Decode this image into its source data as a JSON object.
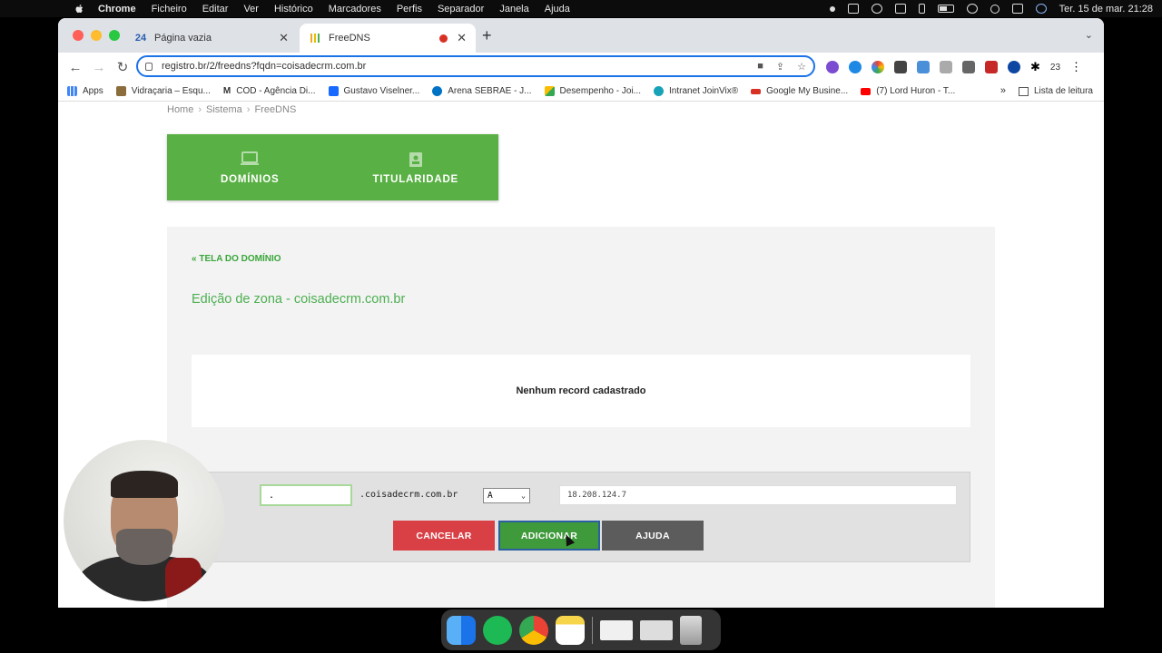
{
  "menubar": {
    "app": "Chrome",
    "items": [
      "Ficheiro",
      "Editar",
      "Ver",
      "Histórico",
      "Marcadores",
      "Perfis",
      "Separador",
      "Janela",
      "Ajuda"
    ],
    "datetime": "Ter. 15 de mar.  21:28"
  },
  "tabs": [
    {
      "label": "Página vazia",
      "favicon": "24"
    },
    {
      "label": "FreeDNS"
    }
  ],
  "address": {
    "url": "registro.br/2/freedns?fqdn=coisadecrm.com.br"
  },
  "extensions": {
    "count": "23"
  },
  "bookmarks": [
    {
      "label": "Apps",
      "color": "#4285f4"
    },
    {
      "label": "Vidraçaria – Esqu...",
      "color": "#8a6d3b"
    },
    {
      "label": "COD - Agência Di...",
      "color": "#111111",
      "glyph": "M"
    },
    {
      "label": "Gustavo Viselner...",
      "color": "#1769ff"
    },
    {
      "label": "Arena SEBRAE - J...",
      "color": "#0073c6"
    },
    {
      "label": "Desempenho - Joi...",
      "color": "#fbbc04"
    },
    {
      "label": "Intranet JoinVix®",
      "color": "#17a2b8"
    },
    {
      "label": "Google My Busine...",
      "color": "#d93025"
    },
    {
      "label": "(7) Lord Huron - T...",
      "color": "#ff0000"
    }
  ],
  "bookmarks_more": "»",
  "reading_list": "Lista de leitura",
  "breadcrumb": [
    "Home",
    "Sistema",
    "FreeDNS"
  ],
  "green_nav": [
    {
      "label": "DOMÍNIOS"
    },
    {
      "label": "TITULARIDADE"
    }
  ],
  "back_link": "« TELA DO DOMÍNIO",
  "zone_title": "Edição de zona - coisadecrm.com.br",
  "records_empty": "Nenhum record cadastrado",
  "form": {
    "host_value": ".",
    "domain_suffix": ".coisadecrm.com.br",
    "record_type": "A",
    "record_value": "18.208.124.7"
  },
  "buttons": {
    "cancel": "CANCELAR",
    "add": "ADICIONAR",
    "help": "AJUDA"
  },
  "colors": {
    "brand_green": "#59b044",
    "cancel_red": "#d94046",
    "add_green": "#3f9a3b",
    "help_gray": "#5c5c5c"
  }
}
